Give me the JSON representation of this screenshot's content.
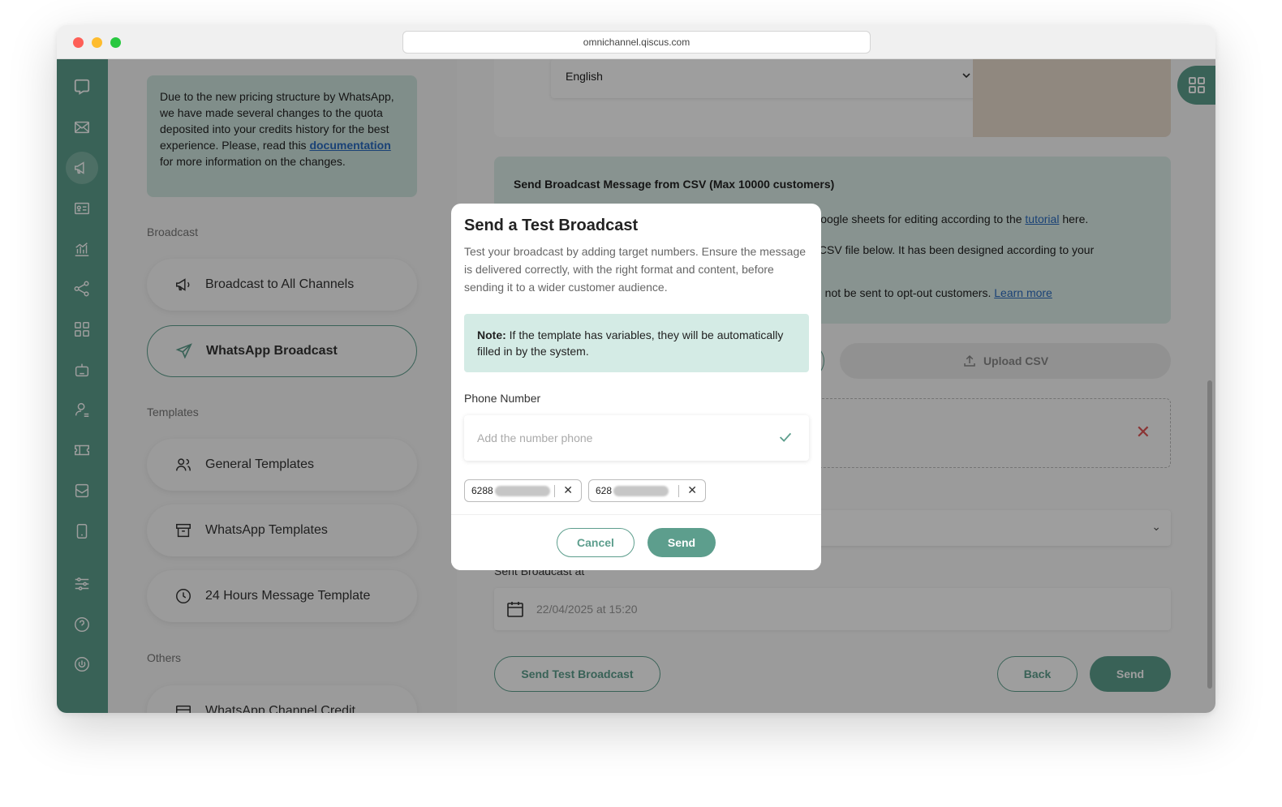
{
  "browser": {
    "url": "omnichannel.qiscus.com"
  },
  "notice": {
    "text_before": "Due to the new pricing structure by WhatsApp, we have made several changes to the quota deposited into your credits history for the best experience. Please, read this ",
    "link": "documentation",
    "text_after": " for more information on the changes."
  },
  "sidebar": {
    "section_broadcast": "Broadcast",
    "broadcast_all": "Broadcast to All Channels",
    "whatsapp_broadcast": "WhatsApp Broadcast",
    "section_templates": "Templates",
    "general_templates": "General Templates",
    "whatsapp_templates": "WhatsApp Templates",
    "hours_template": "24 Hours Message Template",
    "section_others": "Others",
    "channel_credit": "WhatsApp Channel Credit"
  },
  "form": {
    "language": "English",
    "csv_title": "Send Broadcast Message from CSV (Max 10000 customers)",
    "csv_line1_text": "using Google sheets for editing according to the ",
    "csv_line1_link": "tutorial",
    "csv_line1_after": " here.",
    "csv_line2": "loaded CSV file below. It has been designed according to your",
    "csv_line3_text": "ates will not be sent to opt-out customers. ",
    "csv_line3_link": "Learn more",
    "upload_csv": "Upload CSV",
    "sent_broadcast_at_label": "Sent Broadcast at",
    "sent_broadcast_at_value": "22/04/2025 at 15:20",
    "send_test_broadcast": "Send Test Broadcast",
    "back": "Back",
    "send": "Send"
  },
  "modal": {
    "title": "Send a Test Broadcast",
    "description": "Test your broadcast by adding target numbers. Ensure the message is delivered correctly, with the right format and content, before sending it to a wider customer audience.",
    "note_label": "Note:",
    "note_text": " If the template has variables, they will be automatically filled in by the system.",
    "phone_label": "Phone Number",
    "phone_placeholder": "Add the number phone",
    "chips": [
      "6288",
      "628"
    ],
    "cancel": "Cancel",
    "send": "Send"
  },
  "colors": {
    "brand": "#5d9e8d",
    "note_bg": "#d4ebe5",
    "link": "#2a6bbf",
    "error": "#e05555"
  }
}
